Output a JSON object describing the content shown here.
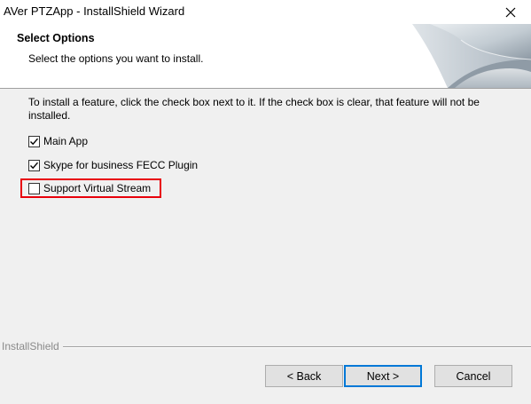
{
  "window": {
    "title": "AVer PTZApp - InstallShield Wizard"
  },
  "header": {
    "title": "Select Options",
    "subtitle": "Select the options you want to install."
  },
  "main": {
    "instructions": "To install a feature, click the check box next to it.  If the check box is clear, that feature will not be installed.",
    "options": [
      {
        "label": "Main App",
        "checked": true
      },
      {
        "label": "Skype for business FECC Plugin",
        "checked": true
      },
      {
        "label": "Support Virtual Stream",
        "checked": false,
        "highlighted": true
      }
    ]
  },
  "footer": {
    "brand_label": "InstallShield",
    "back_label": "< Back",
    "next_label": "Next >",
    "cancel_label": "Cancel"
  },
  "colors": {
    "highlight": "#e8000b",
    "default_button_border": "#0078d7"
  },
  "icons": {
    "close": "close-icon",
    "checkmark": "checkmark-icon"
  }
}
